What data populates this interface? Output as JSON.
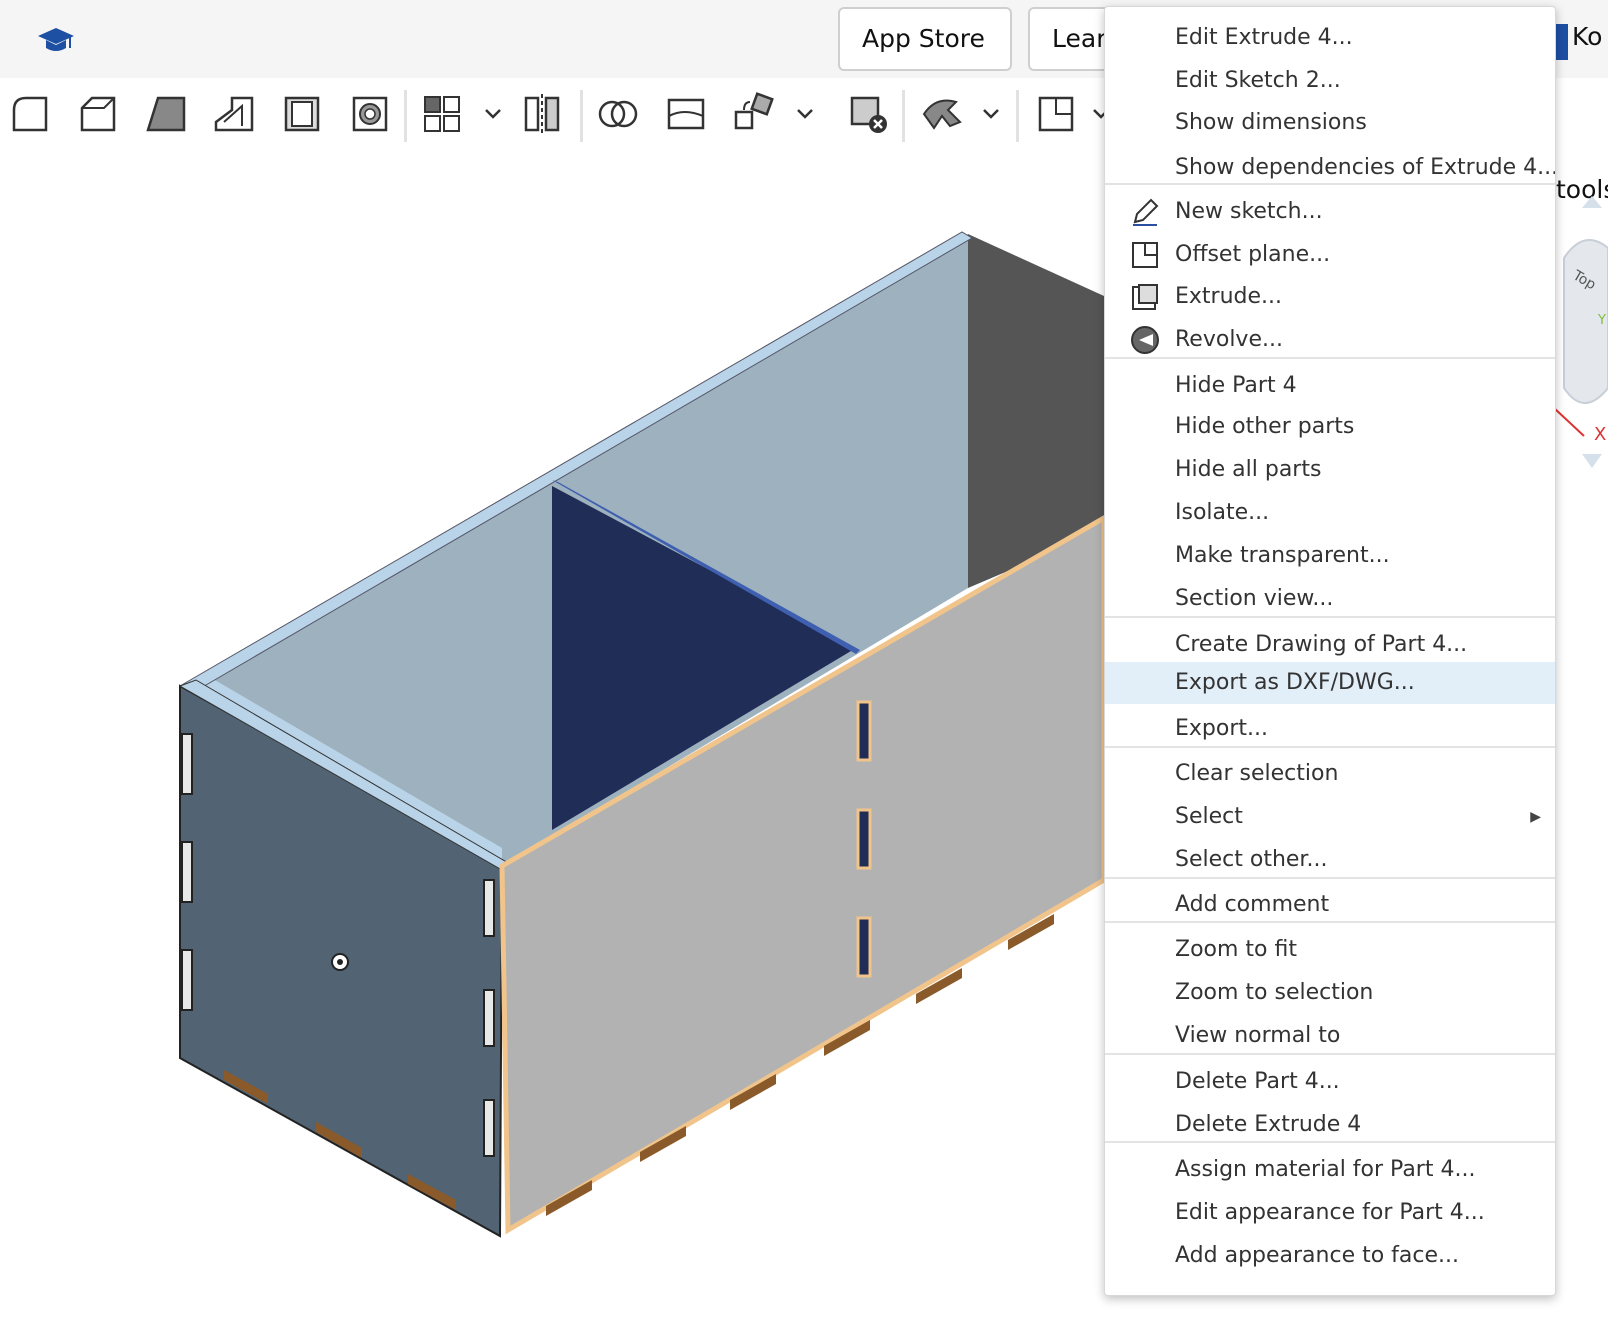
{
  "header": {
    "app_store_label": "App Store",
    "learning_label": "Lear",
    "user_label": "Ko"
  },
  "toolbar": {
    "tools": [
      "fillet",
      "chamfer",
      "draft",
      "rib",
      "shell",
      "hole",
      "linear-pattern",
      "mirror",
      "boolean",
      "split",
      "transform",
      "delete-part",
      "plane-tool",
      "plane"
    ],
    "tools_label": "tools"
  },
  "context_menu": {
    "groups": [
      [
        "Edit Extrude 4...",
        "Edit Sketch 2...",
        "Show dimensions",
        "Show dependencies of Extrude 4..."
      ],
      [
        "New sketch...",
        "Offset plane...",
        "Extrude...",
        "Revolve..."
      ],
      [
        "Hide Part 4",
        "Hide other parts",
        "Hide all parts",
        "Isolate...",
        "Make transparent...",
        "Section view..."
      ],
      [
        "Create Drawing of Part 4...",
        "Export as DXF/DWG...",
        "Export..."
      ],
      [
        "Clear selection",
        "Select",
        "Select other..."
      ],
      [
        "Add comment"
      ],
      [
        "Zoom to fit",
        "Zoom to selection",
        "View normal to"
      ],
      [
        "Delete Part 4...",
        "Delete Extrude 4"
      ],
      [
        "Assign material for Part 4...",
        "Edit appearance for Part 4...",
        "Add appearance to face..."
      ]
    ],
    "highlighted_item": "Export as DXF/DWG...",
    "icons": {
      "New sketch...": "pencil-icon",
      "Offset plane...": "plane-icon",
      "Extrude...": "extrude-icon",
      "Revolve...": "revolve-icon"
    }
  },
  "view_cube": {
    "face_label": "Top",
    "axis_x": "X",
    "axis_y": "Y"
  },
  "colors": {
    "accent_blue": "#1d4fa3",
    "highlight": "#e2eef8",
    "selection_orange": "#f0c48a",
    "dark_panel": "#1f2d57"
  }
}
